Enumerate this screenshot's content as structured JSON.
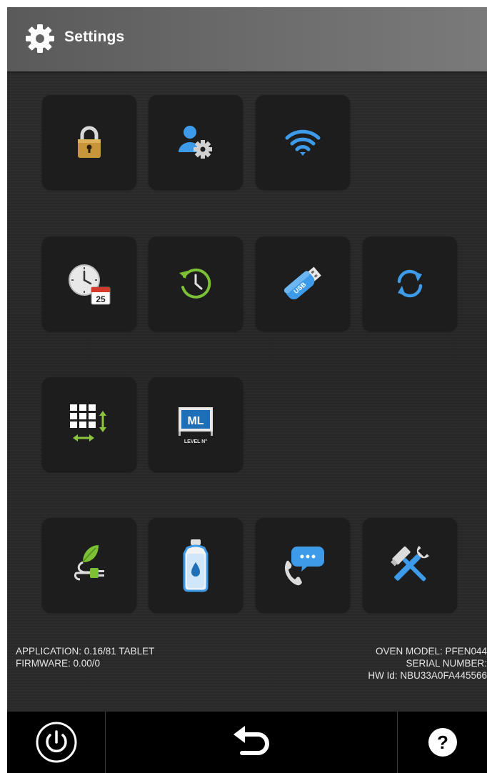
{
  "header": {
    "title": "Settings",
    "icon": "gear-icon"
  },
  "tiles": [
    {
      "name": "lock-tile",
      "icon": "padlock-icon"
    },
    {
      "name": "user-settings-tile",
      "icon": "user-gear-icon"
    },
    {
      "name": "wifi-tile",
      "icon": "wifi-icon"
    },
    {
      "name": "date-time-tile",
      "icon": "clock-calendar-icon",
      "calendar_day": "25"
    },
    {
      "name": "history-tile",
      "icon": "clock-history-icon"
    },
    {
      "name": "usb-tile",
      "icon": "usb-drive-icon",
      "usb_label": "USB"
    },
    {
      "name": "sync-tile",
      "icon": "sync-icon"
    },
    {
      "name": "keypad-tile",
      "icon": "keypad-resize-icon"
    },
    {
      "name": "level-tile",
      "icon": "ml-level-icon",
      "ml_text": "ML",
      "level_text": "LEVEL N°"
    },
    {
      "name": "eco-tile",
      "icon": "eco-leaf-plug-icon"
    },
    {
      "name": "water-tile",
      "icon": "water-bottle-icon"
    },
    {
      "name": "support-tile",
      "icon": "phone-chat-icon"
    },
    {
      "name": "service-tile",
      "icon": "wrench-hammer-icon"
    }
  ],
  "info": {
    "application": "APPLICATION: 0.16/81 TABLET",
    "firmware": "FIRMWARE: 0.00/0",
    "oven_model": "OVEN MODEL: PFEN044",
    "serial_number": "SERIAL NUMBER:",
    "hw_id": "HW Id: NBU33A0FA445566"
  },
  "footer": {
    "power": "power-icon",
    "back": "back-arrow-icon",
    "help": "help-icon",
    "help_glyph": "?"
  },
  "colors": {
    "tile_bg": "#1d1d1d",
    "accent_blue": "#3d9be9",
    "accent_green": "#7cc035",
    "lock_gold": "#c8963a"
  }
}
